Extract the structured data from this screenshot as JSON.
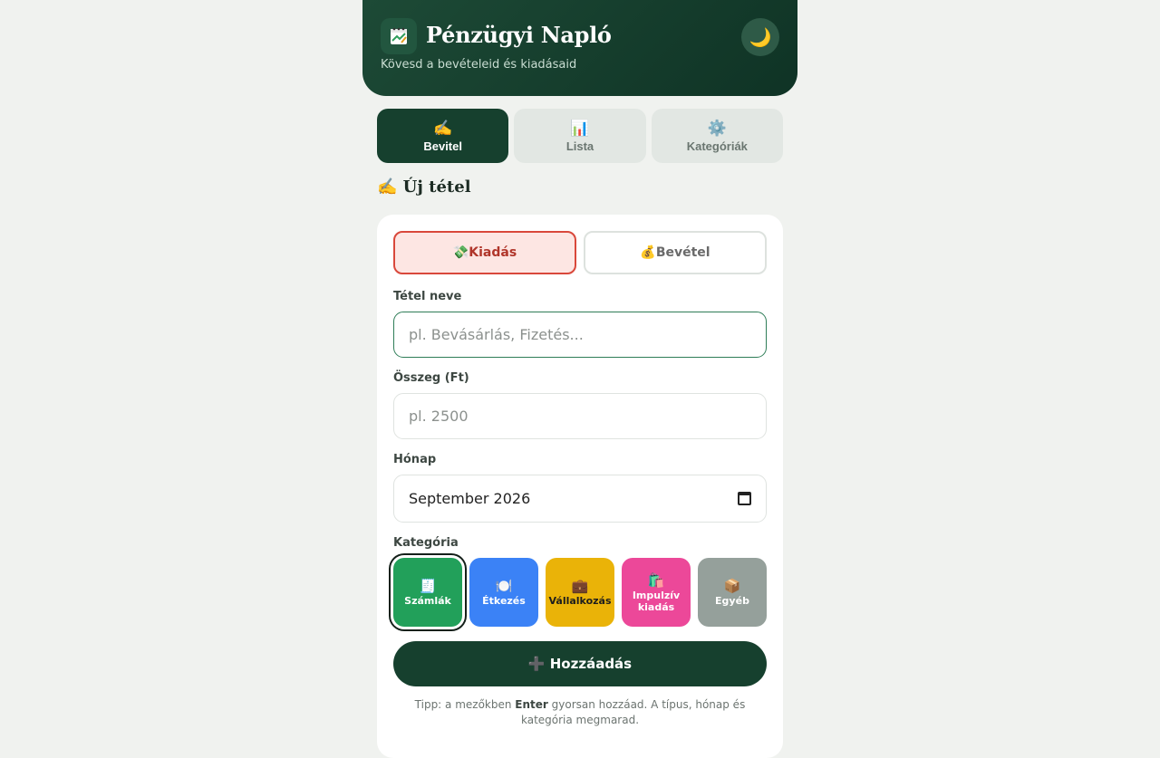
{
  "header": {
    "logo_icon": "notebook-icon",
    "title": "Pénzügyi Napló",
    "subtitle": "Kövesd a bevételeid és kiadásaid",
    "theme_toggle_icon": "🌙"
  },
  "tabs": [
    {
      "icon": "✍️",
      "label": "Bevitel",
      "active": true
    },
    {
      "icon": "📊",
      "label": "Lista",
      "active": false
    },
    {
      "icon": "⚙️",
      "label": "Kategóriák",
      "active": false
    }
  ],
  "section_title": "✍️ Új tétel",
  "form": {
    "type_expense": "💸Kiadás",
    "type_income": "💰Bevétel",
    "name_label": "Tétel neve",
    "name_placeholder": "pl. Bevásárlás, Fizetés...",
    "amount_label": "Összeg (Ft)",
    "amount_placeholder": "pl. 2500",
    "month_label": "Hónap",
    "month_value": "September 2026",
    "category_label": "Kategória",
    "categories": [
      {
        "icon": "🧾",
        "label": "Számlák",
        "color": "#22a05a",
        "selected": true
      },
      {
        "icon": "🍽️",
        "label": "Étkezés",
        "color": "#3b82f6",
        "selected": false
      },
      {
        "icon": "💼",
        "label": "Vállalkozás",
        "color": "#eab308",
        "selected": false
      },
      {
        "icon": "🛍️",
        "label": "Impulzív kiadás",
        "color": "#ec4899",
        "selected": false
      },
      {
        "icon": "📦",
        "label": "Egyéb",
        "color": "#95a09b",
        "selected": false
      }
    ],
    "add_button": "➕ Hozzáadás",
    "tip_prefix": "Tipp: a mezőkben ",
    "tip_key": "Enter",
    "tip_suffix": " gyorsan hozzáad. A típus, hónap és kategória megmarad."
  },
  "colors": {
    "primary": "#16402e",
    "expense_accent": "#d9483b",
    "background": "#f0f2ef"
  }
}
